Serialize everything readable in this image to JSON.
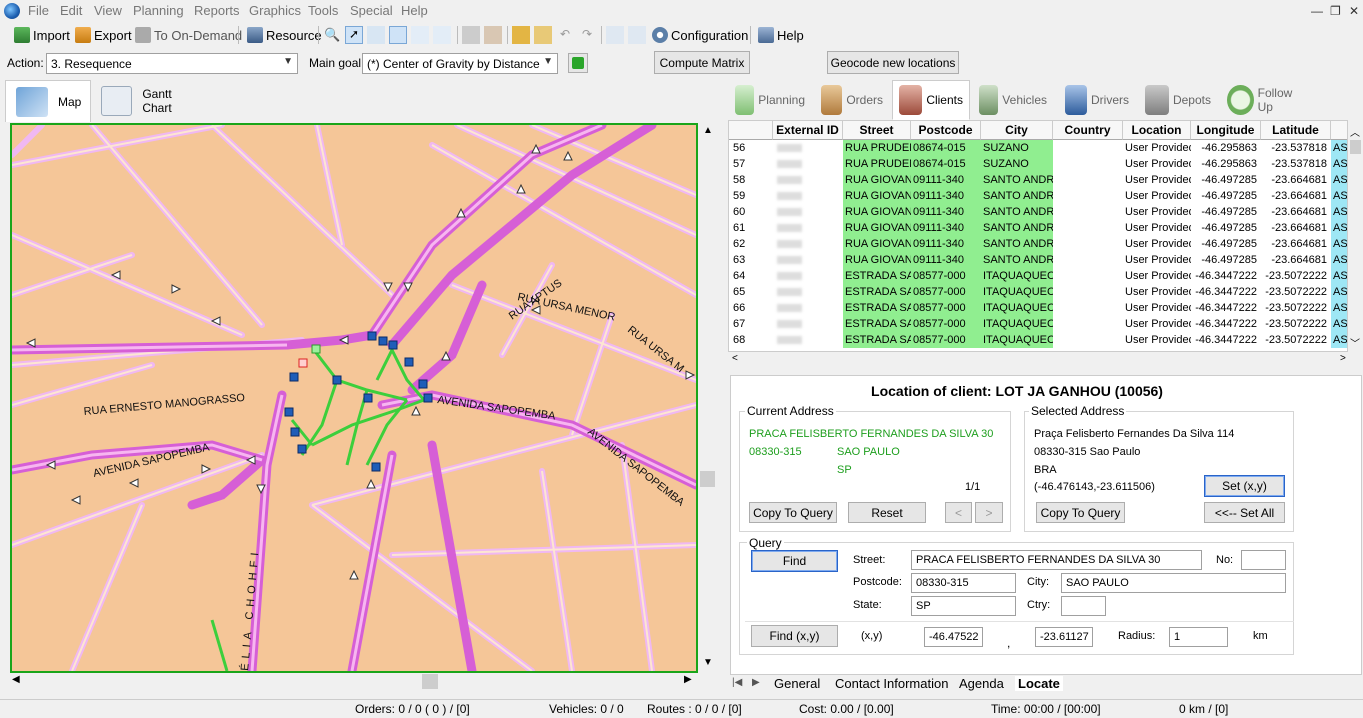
{
  "menu": {
    "items": [
      "File",
      "Edit",
      "View",
      "Planning",
      "Reports",
      "Graphics",
      "Tools",
      "Special",
      "Help"
    ]
  },
  "window_controls": {
    "minimize": "—",
    "restore": "❐",
    "close": "✕"
  },
  "toolbar": {
    "import": "Import",
    "export": "Export",
    "on_demand": "To On-Demand",
    "resource": "Resource",
    "configuration": "Configuration",
    "help": "Help"
  },
  "actionbar": {
    "action_label": "Action:",
    "action_value": "3. Resequence",
    "goal_label": "Main goal:",
    "goal_value": "(*) Center of Gravity by Distance",
    "compute_matrix": "Compute Matrix",
    "geocode": "Geocode new locations"
  },
  "left_tabs": {
    "map": "Map",
    "gantt": "Gantt Chart"
  },
  "map": {
    "street_labels": [
      "RUA ERNESTO MANOGRASSO",
      "AVENIDA SAPOPEMBA",
      "AVENIDA SAPOPEMBA",
      "AVENIDA SAPOPEMBA",
      "RUA URSA MENOR",
      "RUA URSA M",
      "RUA APTUS",
      "ÉLIA CHOHFI"
    ]
  },
  "right_tabs": [
    "Planning",
    "Orders",
    "Clients",
    "Vehicles",
    "Drivers",
    "Depots",
    "Follow Up"
  ],
  "grid": {
    "columns": [
      "External ID",
      "Street",
      "Postcode",
      "City",
      "Country",
      "Location",
      "Longitude",
      "Latitude"
    ],
    "rows": [
      {
        "n": "56",
        "street": "RUA PRUDEN",
        "postcode": "08674-015",
        "city": "SUZANO",
        "location": "User Provided",
        "lon": "-46.295863",
        "lat": "-23.537818",
        "tail": "AS"
      },
      {
        "n": "57",
        "street": "RUA PRUDEN",
        "postcode": "08674-015",
        "city": "SUZANO",
        "location": "User Provided",
        "lon": "-46.295863",
        "lat": "-23.537818",
        "tail": "AS"
      },
      {
        "n": "58",
        "street": "RUA GIOVAN",
        "postcode": "09111-340",
        "city": "SANTO ANDR",
        "location": "User Provided",
        "lon": "-46.497285",
        "lat": "-23.664681",
        "tail": "AS"
      },
      {
        "n": "59",
        "street": "RUA GIOVAN",
        "postcode": "09111-340",
        "city": "SANTO ANDR",
        "location": "User Provided",
        "lon": "-46.497285",
        "lat": "-23.664681",
        "tail": "AS"
      },
      {
        "n": "60",
        "street": "RUA GIOVAN",
        "postcode": "09111-340",
        "city": "SANTO ANDR",
        "location": "User Provided",
        "lon": "-46.497285",
        "lat": "-23.664681",
        "tail": "AS"
      },
      {
        "n": "61",
        "street": "RUA GIOVAN",
        "postcode": "09111-340",
        "city": "SANTO ANDR",
        "location": "User Provided",
        "lon": "-46.497285",
        "lat": "-23.664681",
        "tail": "AS"
      },
      {
        "n": "62",
        "street": "RUA GIOVAN",
        "postcode": "09111-340",
        "city": "SANTO ANDR",
        "location": "User Provided",
        "lon": "-46.497285",
        "lat": "-23.664681",
        "tail": "AS"
      },
      {
        "n": "63",
        "street": "RUA GIOVAN",
        "postcode": "09111-340",
        "city": "SANTO ANDR",
        "location": "User Provided",
        "lon": "-46.497285",
        "lat": "-23.664681",
        "tail": "AS"
      },
      {
        "n": "64",
        "street": "ESTRADA SA",
        "postcode": "08577-000",
        "city": "ITAQUAQUEC",
        "location": "User Provided",
        "lon": "-46.3447222",
        "lat": "-23.5072222",
        "tail": "AS"
      },
      {
        "n": "65",
        "street": "ESTRADA SA",
        "postcode": "08577-000",
        "city": "ITAQUAQUEC",
        "location": "User Provided",
        "lon": "-46.3447222",
        "lat": "-23.5072222",
        "tail": "AS"
      },
      {
        "n": "66",
        "street": "ESTRADA SA",
        "postcode": "08577-000",
        "city": "ITAQUAQUEC",
        "location": "User Provided",
        "lon": "-46.3447222",
        "lat": "-23.5072222",
        "tail": "AS"
      },
      {
        "n": "67",
        "street": "ESTRADA SA",
        "postcode": "08577-000",
        "city": "ITAQUAQUEC",
        "location": "User Provided",
        "lon": "-46.3447222",
        "lat": "-23.5072222",
        "tail": "AS"
      },
      {
        "n": "68",
        "street": "ESTRADA SA",
        "postcode": "08577-000",
        "city": "ITAQUAQUEC",
        "location": "User Provided",
        "lon": "-46.3447222",
        "lat": "-23.5072222",
        "tail": "AS"
      }
    ]
  },
  "detail": {
    "title": "Location of client: LOT JA GANHOU (10056)",
    "current": {
      "heading": "Current Address",
      "street": "PRACA FELISBERTO FERNANDES DA SILVA 30",
      "postcode": "08330-315",
      "city": "SAO PAULO",
      "state": "SP",
      "pager": "1/1",
      "copy": "Copy To Query",
      "reset": "Reset",
      "prev": "<",
      "next": ">"
    },
    "selected": {
      "heading": "Selected Address",
      "line1": "Praça Felisberto Fernandes Da Silva  114",
      "line2": "08330-315  Sao Paulo",
      "line3": "BRA",
      "coords": "(-46.476143,-23.611506)",
      "set": "Set (x,y)",
      "copy": "Copy To Query",
      "set_all": "<<-- Set All"
    },
    "query": {
      "heading": "Query",
      "find": "Find",
      "street_label": "Street:",
      "street": "PRACA FELISBERTO FERNANDES DA SILVA 30",
      "no_label": "No:",
      "no": "",
      "postcode_label": "Postcode:",
      "postcode": "08330-315",
      "city_label": "City:",
      "city": "SAO PAULO",
      "state_label": "State:",
      "state": "SP",
      "ctry_label": "Ctry:",
      "ctry": "",
      "find_xy": "Find (x,y)",
      "xy_label": "(x,y)",
      "x": "-46.47522",
      "y": "-23.61127",
      "comma": ",",
      "radius_label": "Radius:",
      "radius": "1",
      "unit": "km"
    }
  },
  "bottom_tabs": [
    "General",
    "Contact Information",
    "Agenda",
    "Locate"
  ],
  "status": {
    "orders": "Orders: 0 / 0 ( 0 ) / [0]",
    "vehicles": "Vehicles: 0 / 0",
    "routes": "Routes  : 0 / 0 / [0]",
    "cost": "Cost: 0.00 / [0.00]",
    "time": "Time: 00:00 / [00:00]",
    "distance": "0 km / [0]"
  }
}
